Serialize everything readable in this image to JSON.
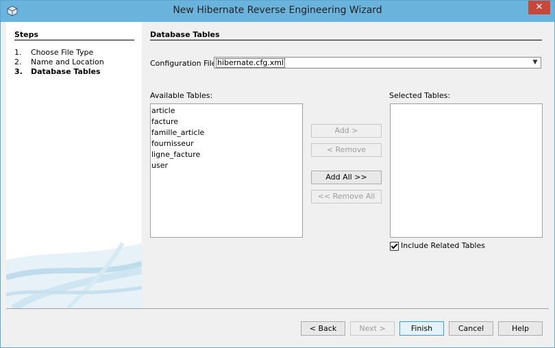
{
  "window": {
    "title": "New Hibernate Reverse Engineering Wizard",
    "close_glyph": "✕"
  },
  "steps": {
    "header": "Steps",
    "items": [
      {
        "num": "1.",
        "label": "Choose File Type"
      },
      {
        "num": "2.",
        "label": "Name and Location"
      },
      {
        "num": "3.",
        "label": "Database Tables"
      }
    ]
  },
  "panel": {
    "title": "Database Tables",
    "config_label": "Configuration File:",
    "config_value": "hibernate.cfg.xml",
    "available_label": "Available Tables:",
    "selected_label": "Selected Tables:",
    "available_tables": [
      "article",
      "facture",
      "famille_article",
      "fournisseur",
      "ligne_facture",
      "user"
    ],
    "selected_tables": [],
    "buttons": {
      "add": "Add >",
      "remove": "< Remove",
      "add_all": "Add All >>",
      "remove_all": "<< Remove All"
    },
    "include_related": {
      "label": "Include Related Tables",
      "checked": true
    }
  },
  "footer": {
    "back": "< Back",
    "next": "Next >",
    "finish": "Finish",
    "cancel": "Cancel",
    "help": "Help"
  },
  "colors": {
    "titlebar": "#6ab3dc",
    "close": "#c7473a",
    "default_button_border": "#3399ff"
  }
}
